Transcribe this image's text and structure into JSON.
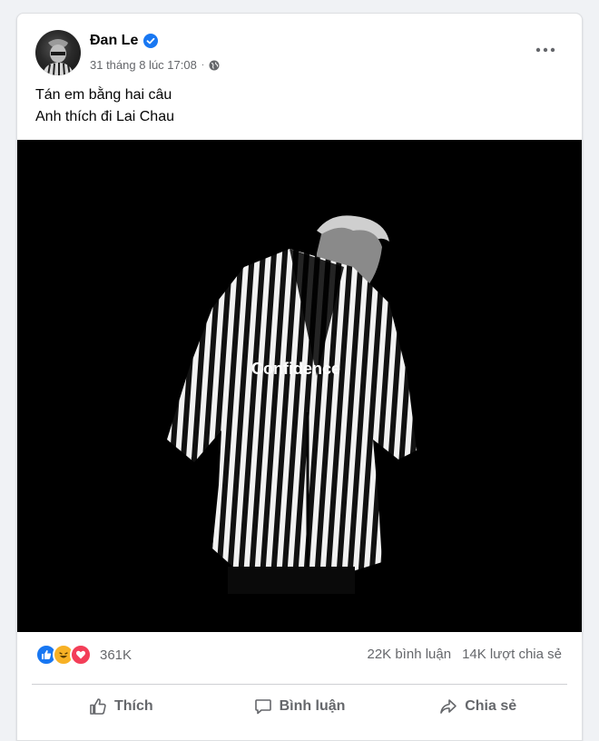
{
  "post": {
    "author": "Đan Le",
    "verified": true,
    "timestamp": "31 tháng 8 lúc 17:08",
    "audience_icon": "globe-icon",
    "caption_lines": [
      "Tán em bằng hai câu",
      "Anh thích đi Lai Chau"
    ],
    "photo_text": "Confidence"
  },
  "stats": {
    "reaction_icons": [
      "like-icon",
      "haha-icon",
      "love-icon"
    ],
    "reaction_count": "361K",
    "comments": "22K bình luận",
    "shares": "14K lượt chia sẻ"
  },
  "actions": {
    "like": "Thích",
    "comment": "Bình luận",
    "share": "Chia sẻ"
  },
  "colors": {
    "accent": "#1877f2",
    "secondary_text": "#65676b",
    "love": "#f33e58",
    "haha": "#f7b125"
  }
}
